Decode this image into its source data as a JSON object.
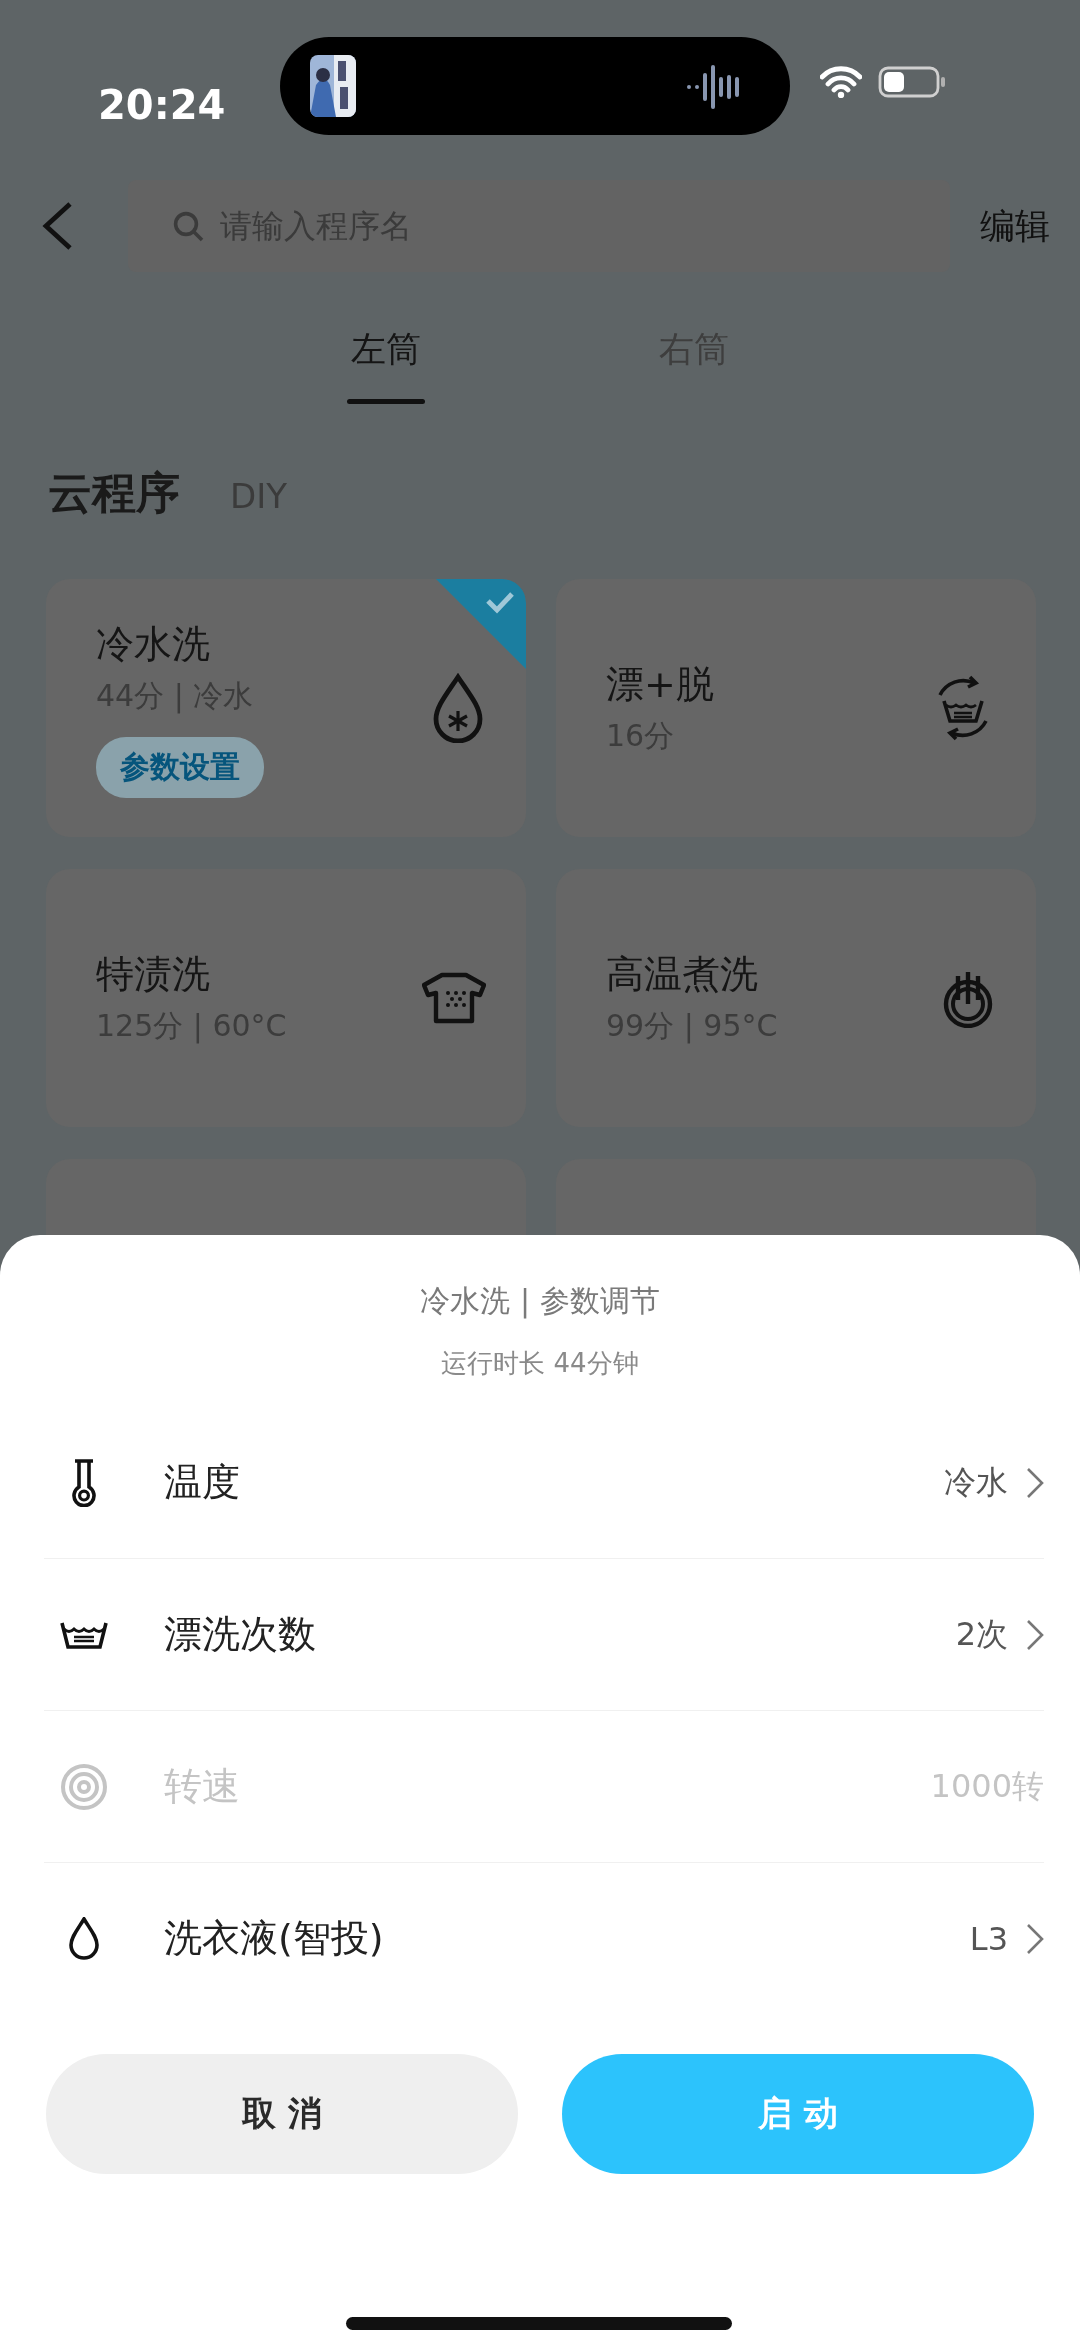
{
  "status_bar": {
    "time": "20:24"
  },
  "header": {
    "search": {
      "placeholder": "请输入程序名"
    },
    "edit": "编辑"
  },
  "tabs": [
    {
      "label": "左筒",
      "selected": true
    },
    {
      "label": "右筒",
      "selected": false
    }
  ],
  "section_tabs": [
    {
      "label": "云程序",
      "selected": true
    },
    {
      "label": "DIY",
      "selected": false
    }
  ],
  "programs": [
    {
      "name": "冷水洗",
      "detail": "44分 | 冷水",
      "selected": true,
      "action": "参数设置"
    },
    {
      "name": "漂+脱",
      "detail": "16分",
      "selected": false
    },
    {
      "name": "特渍洗",
      "detail": "125分 | 60°C",
      "selected": false
    },
    {
      "name": "高温煮洗",
      "detail": "99分 | 95°C",
      "selected": false
    }
  ],
  "sheet": {
    "title": "冷水洗 | 参数调节",
    "subtitle": "运行时长  44分钟",
    "settings": [
      {
        "label": "温度",
        "value": "冷水",
        "disabled": false
      },
      {
        "label": "漂洗次数",
        "value": "2次",
        "disabled": false
      },
      {
        "label": "转速",
        "value": "1000转",
        "disabled": true
      },
      {
        "label": "洗衣液(智投)",
        "value": "L3",
        "disabled": false
      }
    ],
    "buttons": [
      {
        "label": "取 消",
        "kind": "secondary"
      },
      {
        "label": "启 动",
        "kind": "primary"
      }
    ]
  }
}
